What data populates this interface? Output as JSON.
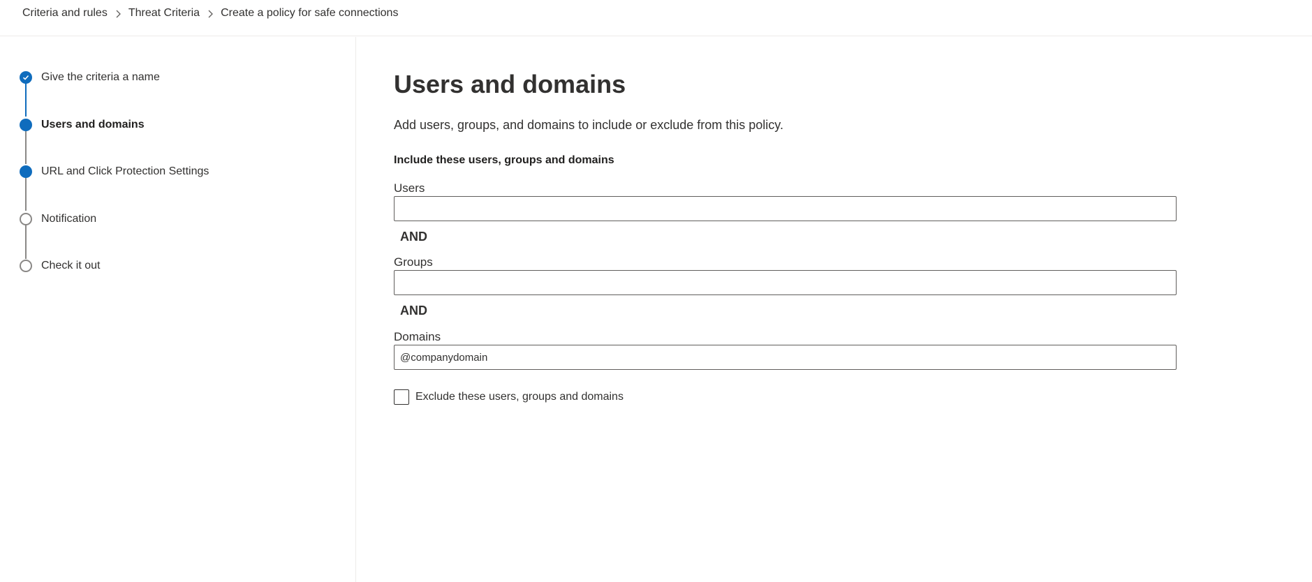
{
  "breadcrumb": {
    "items": [
      "Criteria and rules",
      "Threat Criteria",
      "Create a policy for safe connections"
    ]
  },
  "steps": [
    {
      "label": "Give the criteria a name",
      "state": "completed"
    },
    {
      "label": "Users and domains",
      "state": "current"
    },
    {
      "label": "URL and Click Protection Settings",
      "state": "upcoming"
    },
    {
      "label": "Notification",
      "state": "not-started"
    },
    {
      "label": "Check it out",
      "state": "not-started"
    }
  ],
  "main": {
    "title": "Users and domains",
    "description": "Add users, groups, and domains to include or exclude from this policy.",
    "include_section_title": "Include these users, groups and domains",
    "users": {
      "label": "Users",
      "value": ""
    },
    "and_label_1": "AND",
    "groups": {
      "label": "Groups",
      "value": ""
    },
    "and_label_2": "AND",
    "domains": {
      "label": "Domains",
      "value": "@companydomain"
    },
    "exclude_checkbox": {
      "label": "Exclude these users, groups and domains",
      "checked": false
    }
  },
  "colors": {
    "accent": "#0f6cbd",
    "text": "#323130",
    "border": "#605e5c",
    "divider": "#edebe9"
  }
}
